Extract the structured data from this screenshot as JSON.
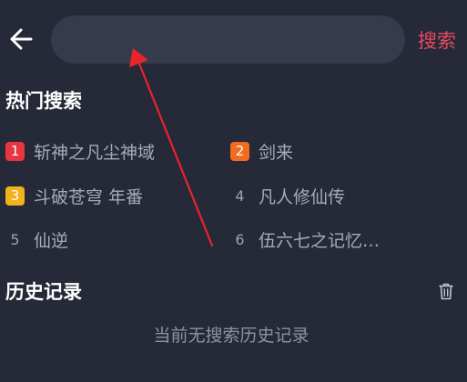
{
  "search": {
    "value": "",
    "placeholder": "",
    "button_label": "搜索"
  },
  "hot": {
    "title": "热门搜索",
    "items": [
      {
        "rank": "1",
        "label": "斩神之凡尘神域",
        "badge_color": "#e8353f"
      },
      {
        "rank": "2",
        "label": "剑来",
        "badge_color": "#f06d1f"
      },
      {
        "rank": "3",
        "label": "斗破苍穹 年番",
        "badge_color": "#f1b21b"
      },
      {
        "rank": "4",
        "label": "凡人修仙传"
      },
      {
        "rank": "5",
        "label": "仙逆"
      },
      {
        "rank": "6",
        "label": "伍六七之记忆…"
      }
    ]
  },
  "history": {
    "title": "历史记录",
    "empty_text": "当前无搜索历史记录"
  },
  "colors": {
    "background": "#252938",
    "search_field": "#353a4c",
    "accent": "#e8495f",
    "annotation_arrow": "#e8242c"
  },
  "icons": {
    "back": "arrow-left-icon",
    "clear": "trash-icon"
  }
}
